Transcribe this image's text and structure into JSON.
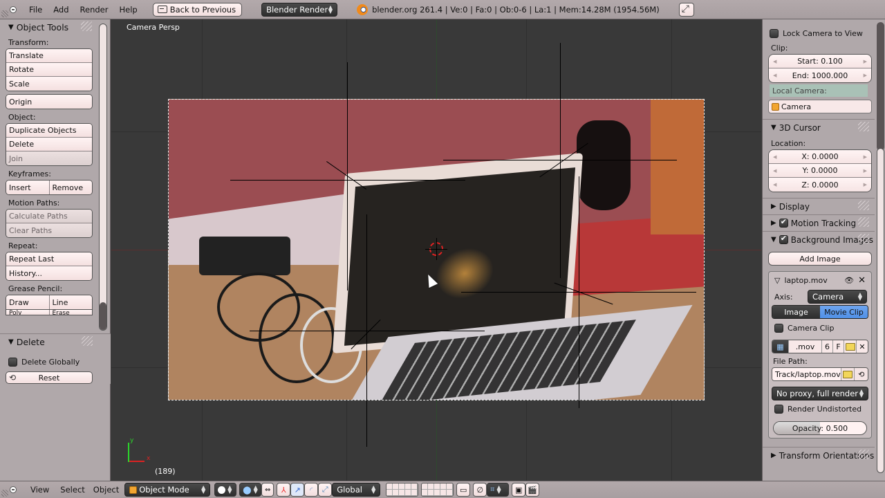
{
  "topbar": {
    "menus": [
      "File",
      "Add",
      "Render",
      "Help"
    ],
    "back_button": "Back to Previous",
    "render_engine": "Blender Render",
    "info": "blender.org 261.4 | Ve:0 | Fa:0 | Ob:0-6 | La:1 | Mem:14.28M (1954.56M)"
  },
  "left_panel": {
    "title": "Object Tools",
    "transform_label": "Transform:",
    "transform_buttons": [
      "Translate",
      "Rotate",
      "Scale"
    ],
    "origin_button": "Origin",
    "object_label": "Object:",
    "object_buttons": [
      "Duplicate Objects",
      "Delete",
      "Join"
    ],
    "keyframes_label": "Keyframes:",
    "keyframe_buttons": [
      "Insert",
      "Remove"
    ],
    "motion_paths_label": "Motion Paths:",
    "motion_path_buttons": [
      "Calculate Paths",
      "Clear Paths"
    ],
    "repeat_label": "Repeat:",
    "repeat_buttons": [
      "Repeat Last",
      "History..."
    ],
    "grease_pencil_label": "Grease Pencil:",
    "grease_pencil_buttons": [
      "Draw",
      "Line",
      "Poly",
      "Erase"
    ],
    "delete_panel": {
      "title": "Delete",
      "delete_globally": "Delete Globally",
      "delete_globally_checked": false,
      "reset_button": "Reset"
    }
  },
  "viewport": {
    "view_label": "Camera Persp",
    "frame_label": "(189)",
    "axis_x": "x",
    "axis_y": "y"
  },
  "right_panel": {
    "lock_camera": "Lock Camera to View",
    "lock_camera_checked": false,
    "clip_label": "Clip:",
    "clip_start": "Start: 0.100",
    "clip_end": "End: 1000.000",
    "local_camera_label": "Local Camera:",
    "local_camera_value": "Camera",
    "cursor_panel": "3D Cursor",
    "location_label": "Location:",
    "location": [
      "X: 0.0000",
      "Y: 0.0000",
      "Z: 0.0000"
    ],
    "display_panel": "Display",
    "motion_tracking_panel": "Motion Tracking",
    "motion_tracking_checked": true,
    "background_images_panel": "Background Images",
    "background_images_checked": true,
    "add_image_button": "Add Image",
    "bg_item": {
      "name": "laptop.mov",
      "axis_label": "Axis:",
      "axis_value": "Camera",
      "source_tabs": [
        "Image",
        "Movie Clip"
      ],
      "active_tab": "Movie Clip",
      "camera_clip": "Camera Clip",
      "camera_clip_checked": false,
      "clip_name": ".mov",
      "clip_users": "6",
      "clip_fake": "F",
      "file_path_label": "File Path:",
      "file_path": "Track/laptop.mov",
      "proxy": "No proxy, full render",
      "render_undistorted": "Render Undistorted",
      "render_undistorted_checked": false,
      "opacity_label": "Opacity: 0.500",
      "opacity_value": 0.5
    },
    "transform_orientations_panel": "Transform Orientations"
  },
  "bottombar": {
    "menus": [
      "View",
      "Select",
      "Object"
    ],
    "mode": "Object Mode",
    "orientation": "Global"
  }
}
